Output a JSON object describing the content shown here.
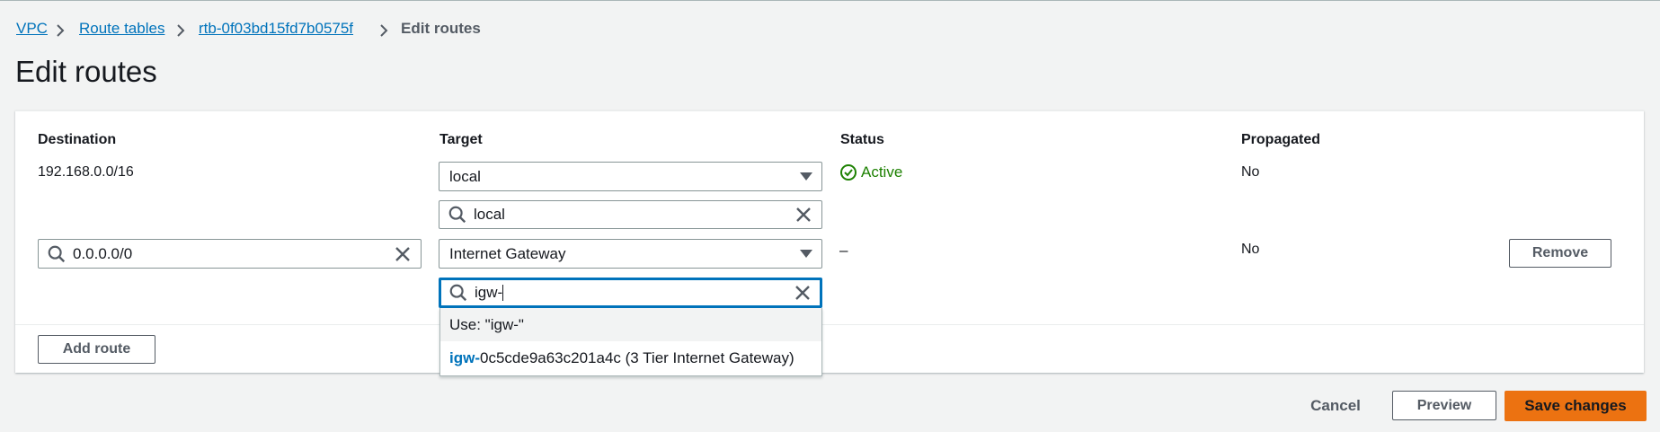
{
  "breadcrumb": {
    "items": [
      {
        "label": "VPC"
      },
      {
        "label": "Route tables"
      },
      {
        "label": "rtb-0f03bd15fd7b0575f"
      }
    ],
    "current": "Edit routes"
  },
  "page": {
    "title": "Edit routes"
  },
  "table": {
    "headers": {
      "destination": "Destination",
      "target": "Target",
      "status": "Status",
      "propagated": "Propagated"
    },
    "rows": [
      {
        "destination": "192.168.0.0/16",
        "target_selected": "local",
        "target_filter": "local",
        "status": "Active",
        "propagated": "No"
      },
      {
        "destination_value": "0.0.0.0/0",
        "target_selected": "Internet Gateway",
        "target_filter": "igw-",
        "status": "–",
        "propagated": "No",
        "remove_label": "Remove"
      }
    ]
  },
  "dropdown": {
    "use_option": "Use: \"igw-\"",
    "options": [
      {
        "match": "igw-",
        "rest": "0c5cde9a63c201a4c (3 Tier Internet Gateway)"
      }
    ]
  },
  "buttons": {
    "add_route": "Add route",
    "cancel": "Cancel",
    "preview": "Preview",
    "save": "Save changes"
  },
  "colors": {
    "link": "#0073bb",
    "primary": "#ec7211",
    "success": "#1d8102",
    "focus": "#0073bb"
  },
  "icons": [
    "chevron-right-icon",
    "search-icon",
    "clear-icon",
    "caret-down-icon",
    "check-circle-icon"
  ]
}
